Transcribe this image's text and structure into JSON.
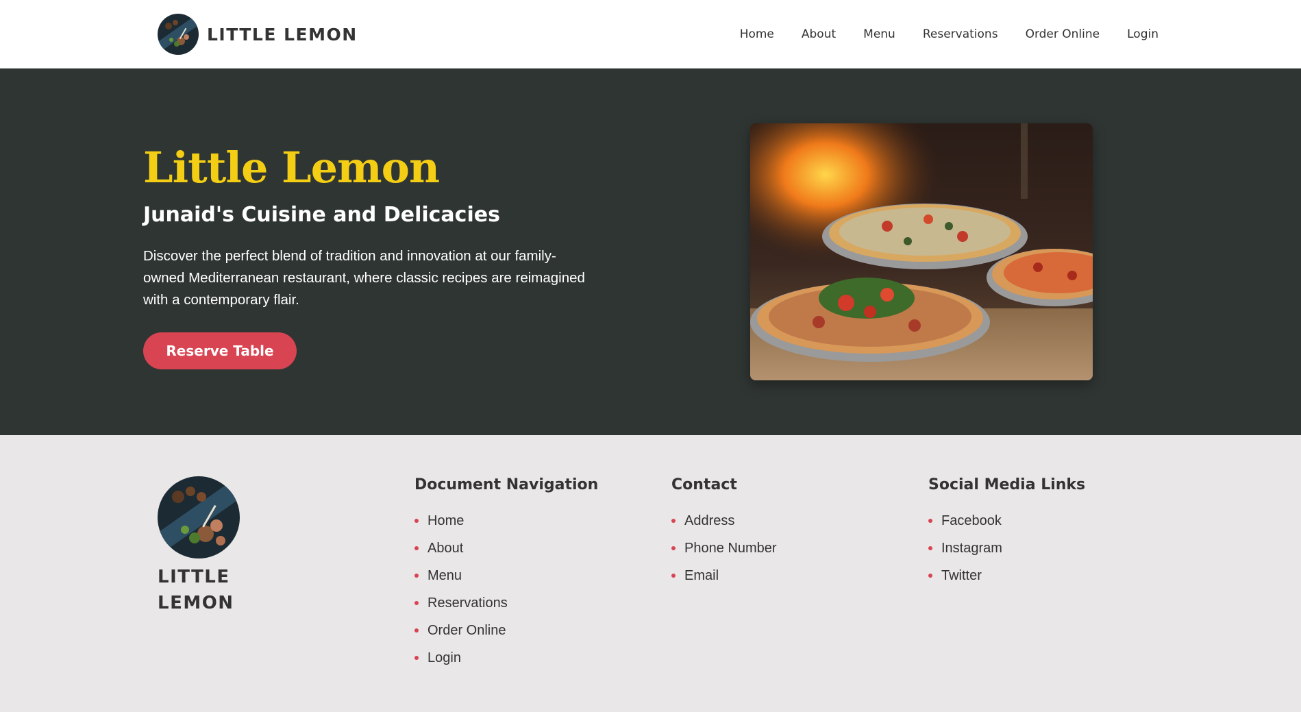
{
  "header": {
    "brand_name": "LITTLE LEMON",
    "nav": [
      "Home",
      "About",
      "Menu",
      "Reservations",
      "Order Online",
      "Login"
    ]
  },
  "hero": {
    "title": "Little Lemon",
    "subtitle": "Junaid's Cuisine and Delicacies",
    "description": "Discover the perfect blend of tradition and innovation at our family-owned Mediterranean restaurant, where classic recipes are reimagined with a contemporary flair.",
    "cta_label": "Reserve Table"
  },
  "footer": {
    "brand_name": "LITTLE LEMON",
    "columns": [
      {
        "heading": "Document Navigation",
        "items": [
          "Home",
          "About",
          "Menu",
          "Reservations",
          "Order Online",
          "Login"
        ]
      },
      {
        "heading": "Contact",
        "items": [
          "Address",
          "Phone Number",
          "Email"
        ]
      },
      {
        "heading": "Social Media Links",
        "items": [
          "Facebook",
          "Instagram",
          "Twitter"
        ]
      }
    ]
  },
  "colors": {
    "hero_bg": "#2f3533",
    "title_yellow": "#f4ce14",
    "accent_red": "#d94452",
    "footer_bg": "#e9e7e8"
  }
}
